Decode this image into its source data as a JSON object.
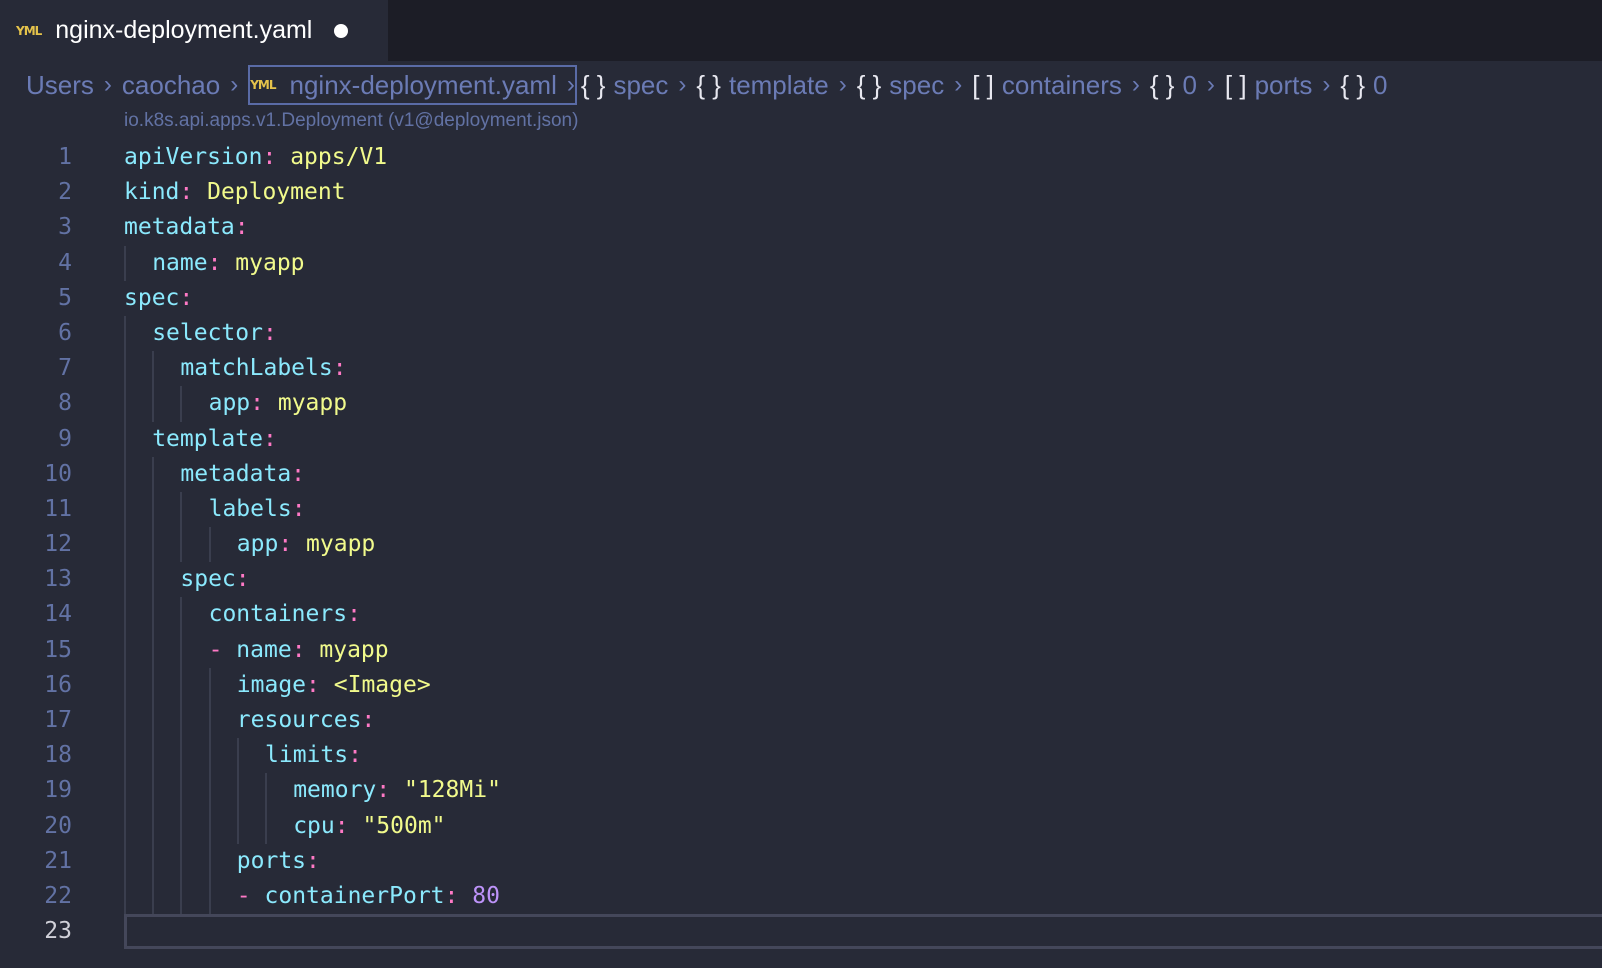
{
  "tab": {
    "title": "nginx-deployment.yaml",
    "icon": "yaml-icon",
    "modified": true
  },
  "breadcrumbs": [
    {
      "label": "Users",
      "sym": ""
    },
    {
      "label": "caochao",
      "sym": ""
    },
    {
      "label": "nginx-deployment.yaml",
      "sym": "YML",
      "active": true
    },
    {
      "label": "spec",
      "sym": "{}"
    },
    {
      "label": "template",
      "sym": "{}"
    },
    {
      "label": "spec",
      "sym": "{}"
    },
    {
      "label": "containers",
      "sym": "[ ]"
    },
    {
      "label": "0",
      "sym": "{}"
    },
    {
      "label": "ports",
      "sym": "[ ]"
    },
    {
      "label": "0",
      "sym": "{}"
    }
  ],
  "schema": "io.k8s.api.apps.v1.Deployment (v1@deployment.json)",
  "current_line": 23,
  "lines": [
    {
      "i": 0,
      "t": [
        [
          "k",
          "apiVersion"
        ],
        [
          "p",
          ": "
        ],
        [
          "s",
          "apps/V1"
        ]
      ]
    },
    {
      "i": 0,
      "t": [
        [
          "k",
          "kind"
        ],
        [
          "p",
          ": "
        ],
        [
          "s",
          "Deployment"
        ]
      ]
    },
    {
      "i": 0,
      "t": [
        [
          "k",
          "metadata"
        ],
        [
          "p",
          ":"
        ]
      ]
    },
    {
      "i": 1,
      "t": [
        [
          "k",
          "name"
        ],
        [
          "p",
          ": "
        ],
        [
          "s",
          "myapp"
        ]
      ]
    },
    {
      "i": 0,
      "t": [
        [
          "k",
          "spec"
        ],
        [
          "p",
          ":"
        ]
      ]
    },
    {
      "i": 1,
      "t": [
        [
          "k",
          "selector"
        ],
        [
          "p",
          ":"
        ]
      ]
    },
    {
      "i": 2,
      "t": [
        [
          "k",
          "matchLabels"
        ],
        [
          "p",
          ":"
        ]
      ]
    },
    {
      "i": 3,
      "t": [
        [
          "k",
          "app"
        ],
        [
          "p",
          ": "
        ],
        [
          "s",
          "myapp"
        ]
      ]
    },
    {
      "i": 1,
      "t": [
        [
          "k",
          "template"
        ],
        [
          "p",
          ":"
        ]
      ]
    },
    {
      "i": 2,
      "t": [
        [
          "k",
          "metadata"
        ],
        [
          "p",
          ":"
        ]
      ]
    },
    {
      "i": 3,
      "t": [
        [
          "k",
          "labels"
        ],
        [
          "p",
          ":"
        ]
      ]
    },
    {
      "i": 4,
      "t": [
        [
          "k",
          "app"
        ],
        [
          "p",
          ": "
        ],
        [
          "s",
          "myapp"
        ]
      ]
    },
    {
      "i": 2,
      "t": [
        [
          "k",
          "spec"
        ],
        [
          "p",
          ":"
        ]
      ]
    },
    {
      "i": 3,
      "t": [
        [
          "k",
          "containers"
        ],
        [
          "p",
          ":"
        ]
      ]
    },
    {
      "i": 3,
      "t": [
        [
          "p",
          "- "
        ],
        [
          "k",
          "name"
        ],
        [
          "p",
          ": "
        ],
        [
          "s",
          "myapp"
        ]
      ]
    },
    {
      "i": 4,
      "t": [
        [
          "k",
          "image"
        ],
        [
          "p",
          ": "
        ],
        [
          "s",
          "<Image>"
        ]
      ]
    },
    {
      "i": 4,
      "t": [
        [
          "k",
          "resources"
        ],
        [
          "p",
          ":"
        ]
      ]
    },
    {
      "i": 5,
      "t": [
        [
          "k",
          "limits"
        ],
        [
          "p",
          ":"
        ]
      ]
    },
    {
      "i": 6,
      "t": [
        [
          "k",
          "memory"
        ],
        [
          "p",
          ": "
        ],
        [
          "s",
          "\"128Mi\""
        ]
      ]
    },
    {
      "i": 6,
      "t": [
        [
          "k",
          "cpu"
        ],
        [
          "p",
          ": "
        ],
        [
          "s",
          "\"500m\""
        ]
      ]
    },
    {
      "i": 4,
      "t": [
        [
          "k",
          "ports"
        ],
        [
          "p",
          ":"
        ]
      ]
    },
    {
      "i": 4,
      "t": [
        [
          "p",
          "- "
        ],
        [
          "k",
          "containerPort"
        ],
        [
          "p",
          ": "
        ],
        [
          "n",
          "80"
        ]
      ]
    },
    {
      "i": 0,
      "t": []
    }
  ]
}
